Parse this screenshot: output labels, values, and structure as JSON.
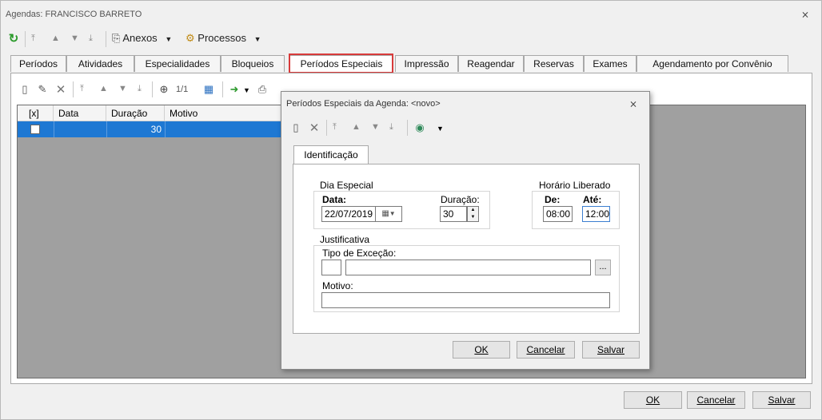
{
  "window": {
    "title": "Agendas: FRANCISCO BARRETO"
  },
  "toolbar": {
    "anexos": "Anexos",
    "processos": "Processos"
  },
  "tabs": [
    "Períodos",
    "Atividades",
    "Especialidades",
    "Bloqueios",
    "Períodos Especiais",
    "Impressão",
    "Reagendar",
    "Reservas",
    "Exames",
    "Agendamento por Convênio"
  ],
  "subtoolbar": {
    "page": "1/1"
  },
  "grid": {
    "headers": [
      "[x]",
      "Data",
      "Duração",
      "Motivo"
    ],
    "rows": [
      {
        "checked": false,
        "data": "",
        "duracao": "30",
        "motivo": ""
      }
    ]
  },
  "dialog": {
    "title": "Períodos Especiais da Agenda: <novo>",
    "tab": "Identificação",
    "dia_especial": {
      "group": "Dia Especial",
      "data_label": "Data:",
      "data_value": "22/07/2019",
      "duracao_label": "Duração:",
      "duracao_value": "30"
    },
    "horario": {
      "group": "Horário Liberado",
      "de_label": "De:",
      "de_value": "08:00",
      "ate_label": "Até:",
      "ate_value": "12:00"
    },
    "justificativa": {
      "group": "Justificativa",
      "tipo_label": "Tipo de Exceção:",
      "tipo_code": "",
      "tipo_desc": "",
      "browse": "...",
      "motivo_label": "Motivo:",
      "motivo_value": ""
    },
    "buttons": {
      "ok": "OK",
      "cancel": "Cancelar",
      "save": "Salvar"
    }
  },
  "footer": {
    "ok": "OK",
    "cancel": "Cancelar",
    "save": "Salvar"
  },
  "colors": {
    "selection": "#1e78d3",
    "highlight": "#d83b3b",
    "grid_bg": "#a0a0a0"
  }
}
